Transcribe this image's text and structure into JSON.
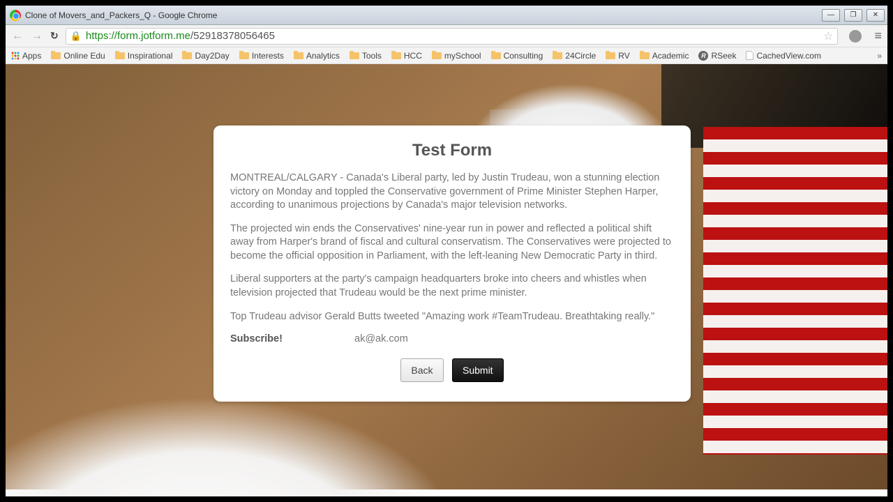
{
  "window": {
    "title": "Clone of Movers_and_Packers_Q - Google Chrome"
  },
  "address": {
    "scheme": "https",
    "host_path": "://form.jotform.me",
    "rest": "/52918378056465"
  },
  "bookmarks": {
    "apps": "Apps",
    "items": [
      {
        "label": "Online Edu",
        "icon": "folder"
      },
      {
        "label": "Inspirational",
        "icon": "folder"
      },
      {
        "label": "Day2Day",
        "icon": "folder"
      },
      {
        "label": "Interests",
        "icon": "folder"
      },
      {
        "label": "Analytics",
        "icon": "folder"
      },
      {
        "label": "Tools",
        "icon": "folder"
      },
      {
        "label": "HCC",
        "icon": "folder"
      },
      {
        "label": "mySchool",
        "icon": "folder"
      },
      {
        "label": "Consulting",
        "icon": "folder"
      },
      {
        "label": "24Circle",
        "icon": "folder"
      },
      {
        "label": "RV",
        "icon": "folder"
      },
      {
        "label": "Academic",
        "icon": "folder"
      },
      {
        "label": "RSeek",
        "icon": "rseek"
      },
      {
        "label": "CachedView.com",
        "icon": "page"
      }
    ],
    "overflow": "»"
  },
  "form": {
    "title": "Test Form",
    "para1": "MONTREAL/CALGARY - Canada's Liberal party, led by Justin Trudeau, won a stunning election victory on Monday and toppled the Conservative government of Prime Minister Stephen Harper, according to unanimous projections by Canada's major television networks.",
    "para2": "The projected win ends the Conservatives' nine-year run in power and reflected a political shift away from Harper's brand of fiscal and cultural conservatism. The Conservatives were projected to become the official opposition in Parliament, with the left-leaning New Democratic Party in third.",
    "para3": "Liberal supporters at the party's campaign headquarters broke into cheers and whistles when television projected that Trudeau would be the next prime minister.",
    "para4": "Top Trudeau advisor Gerald Butts tweeted \"Amazing work #TeamTrudeau. Breathtaking really.\"",
    "subscribe_label": "Subscribe!",
    "subscribe_value": "ak@ak.com",
    "back_label": "Back",
    "submit_label": "Submit"
  }
}
